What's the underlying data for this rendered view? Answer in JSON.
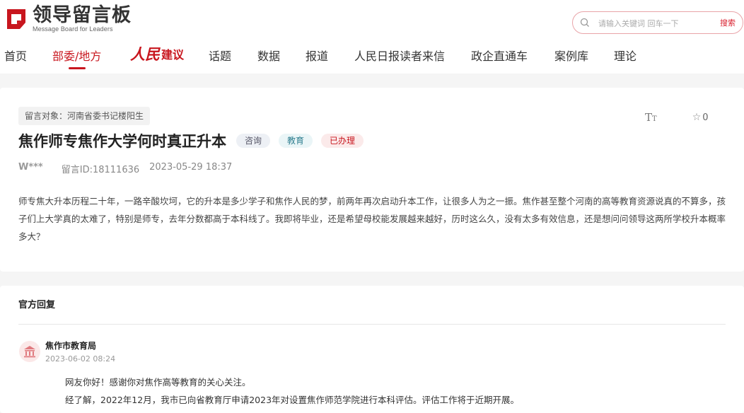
{
  "header": {
    "logo_title": "领导留言板",
    "logo_subtitle": "Message Board for Leaders",
    "search": {
      "placeholder": "请输入关键词 回车一下",
      "button": "搜索"
    }
  },
  "nav": {
    "items": [
      "首页",
      "部委/地方",
      "人民建议",
      "话题",
      "数据",
      "报道",
      "人民日报读者来信",
      "政企直通车",
      "案例库",
      "理论"
    ],
    "rmjy_script": "人民",
    "rmjy_label": "建议",
    "active_index": 1
  },
  "message": {
    "target": "留言对象：河南省委书记楼阳生",
    "title": "焦作师专焦作大学何时真正升本",
    "tags": [
      "咨询",
      "教育",
      "已办理"
    ],
    "author": "W***",
    "message_id": "留言ID:18111636",
    "datetime": "2023-05-29 18:37",
    "font_tool": "TT",
    "favorite_count": "0",
    "content": "师专焦大升本历程二十年，一路辛酸坎坷，它的升本是多少学子和焦作人民的梦，前两年再次启动升本工作，让很多人为之一振。焦作甚至整个河南的高等教育资源说真的不算多，孩子们上大学真的太难了，特别是师专，去年分数都高于本科线了。我即将毕业，还是希望母校能发展越来越好，历时这么久，没有太多有效信息，还是想问问领导这两所学校升本概率多大？"
  },
  "reply": {
    "section_title": "官方回复",
    "org_name": "焦作市教育局",
    "date": "2023-06-02 08:24",
    "paragraphs": [
      "网友你好！感谢你对焦作高等教育的关心关注。",
      "经了解，2022年12月，我市已向省教育厅申请2023年对设置焦作师范学院进行本科评估。评估工作将于近期开展。"
    ]
  },
  "colors": {
    "brand_red": "#c8161e",
    "search_border": "#e9a4a8",
    "background": "#f5f5f5"
  }
}
